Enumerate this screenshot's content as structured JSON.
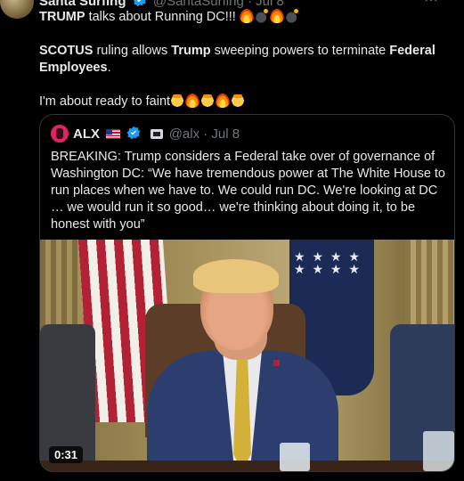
{
  "tweet": {
    "author_name": "Santa Surfing",
    "author_handle": "@SantaSurfing · Jul 8",
    "line1_bold": "TRUMP",
    "line1_rest": " talks about Running DC!!! ",
    "line2_a": "SCOTUS",
    "line2_b": " ruling allows ",
    "line2_c": "Trump",
    "line2_d": " sweeping powers to terminate ",
    "line2_e": "Federal Employees",
    "line2_f": ".",
    "line3": "I'm about ready to faint"
  },
  "quote": {
    "author_name": "ALX",
    "handle_date": "@alx · Jul 8",
    "text": "BREAKING: Trump considers a Federal take over of governance of Washington DC: “We have tremendous power at The White House to run places when we have to. We could run DC. We're looking at DC … we would run it so good… we're thinking about doing it, to be honest with you”",
    "video_time": "0:31"
  },
  "colors": {
    "background": "#000000",
    "text": "#e7e9ea",
    "muted": "#71767b",
    "verified": "#1d9bf0",
    "border": "#2f3336"
  },
  "icons": [
    "verified-badge-icon",
    "fire-emoji",
    "bomb-emoji",
    "faint-face-emoji",
    "us-flag-emoji",
    "id-badge-icon",
    "more-options-icon"
  ]
}
